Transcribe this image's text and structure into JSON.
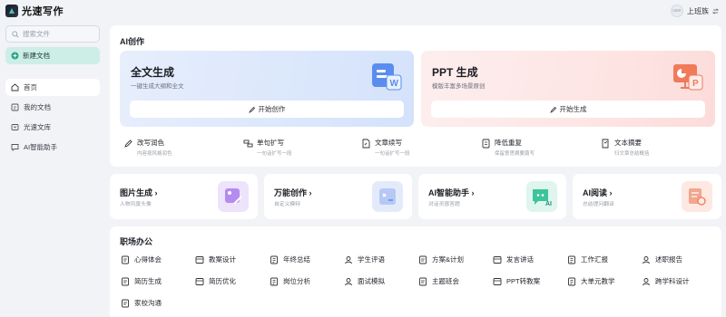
{
  "app": {
    "name": "光速写作"
  },
  "user": {
    "name": "上班族",
    "avatar_text": "user"
  },
  "sidebar": {
    "search_placeholder": "搜索文件",
    "new_doc": "新建文档",
    "items": [
      {
        "label": "首页",
        "active": true
      },
      {
        "label": "我的文档",
        "active": false
      },
      {
        "label": "光速文库",
        "active": false
      },
      {
        "label": "AI智能助手",
        "active": false
      }
    ]
  },
  "ai_section": {
    "title": "AI创作",
    "cards": [
      {
        "title": "全文生成",
        "subtitle": "一键生成大纲和全文",
        "button": "开始创作"
      },
      {
        "title": "PPT 生成",
        "subtitle": "模版丰富多场景原创",
        "button": "开始生成"
      }
    ],
    "tools": [
      {
        "name": "改写润色",
        "desc": "内容按风格润色"
      },
      {
        "name": "单句扩写",
        "desc": "一句话扩写一段"
      },
      {
        "name": "文章续写",
        "desc": "一句话扩写一段"
      },
      {
        "name": "降低重复",
        "desc": "保留意思摘要篇写"
      },
      {
        "name": "文本摘要",
        "desc": "归文章总结概括"
      }
    ]
  },
  "features": [
    {
      "title": "图片生成",
      "subtitle": "人物风景头像",
      "color": "#ede3fb"
    },
    {
      "title": "万能创作",
      "subtitle": "自定义模特",
      "color": "#e3ebfb"
    },
    {
      "title": "AI智能助手",
      "subtitle": "对话灵感答题",
      "color": "#dff5ee"
    },
    {
      "title": "AI阅读",
      "subtitle": "总结提问翻译",
      "color": "#fde8e2"
    }
  ],
  "office": {
    "title": "职场办公",
    "items": [
      "心得体会",
      "教案设计",
      "年终总结",
      "学生评语",
      "方案&计划",
      "发言讲话",
      "工作汇报",
      "述职报告",
      "简历生成",
      "简历优化",
      "岗位分析",
      "面试模拟",
      "主题班会",
      "PPT转教案",
      "大单元教学",
      "跨学科设计",
      "家校沟通"
    ]
  }
}
